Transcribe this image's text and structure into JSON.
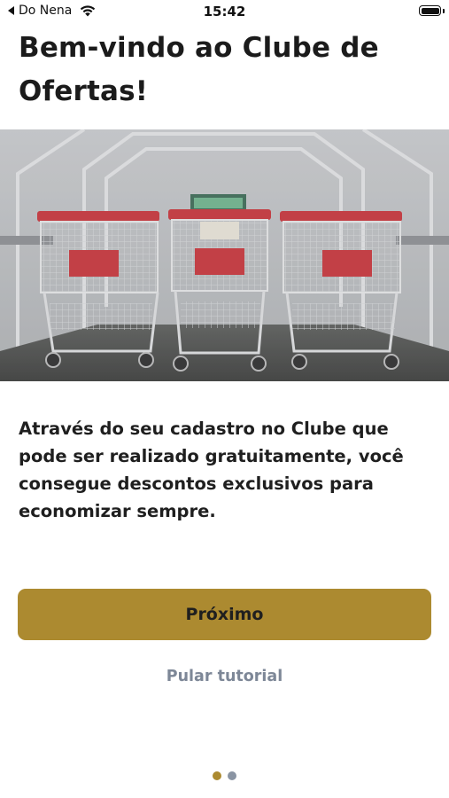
{
  "status_bar": {
    "carrier": "Do Nena",
    "time": "15:42",
    "icons": [
      "back-arrow-icon",
      "wifi-icon",
      "battery-icon"
    ]
  },
  "onboarding": {
    "title": "Bem-vindo ao Clube de Ofertas!",
    "image_subject": "shopping-carts-photo",
    "description": "Através do seu cadastro no Clube que pode ser realizado gratuitamente, você consegue descontos exclusivos para economizar sempre.",
    "primary_button": "Próximo",
    "skip_link": "Pular tutorial",
    "pager": {
      "total": 2,
      "current": 1
    }
  },
  "colors": {
    "accent": "#ac8a30",
    "text": "#1f1f1f",
    "muted": "#7d8797",
    "inactive_dot": "#8a94a3",
    "cart_red": "#c8343a"
  }
}
